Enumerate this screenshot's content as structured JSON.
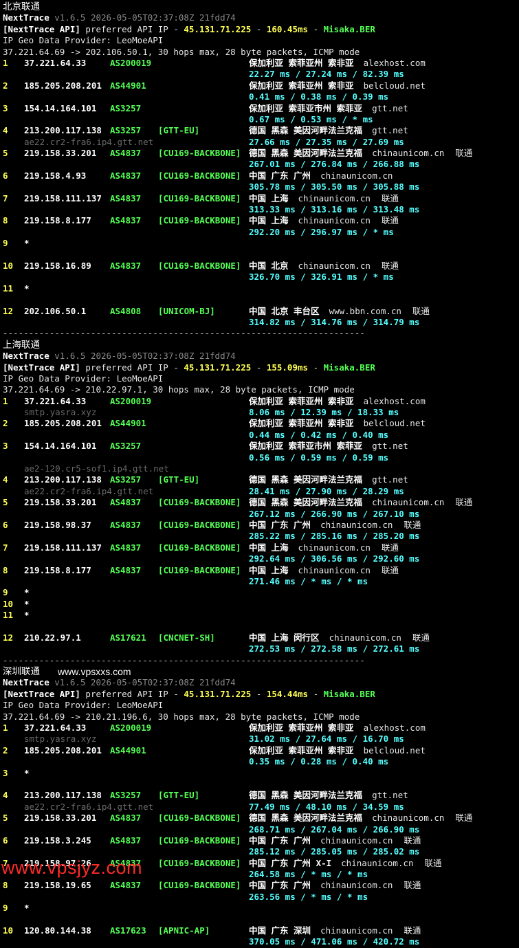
{
  "watermark_top": "www.vpsxxs.com",
  "watermark_bottom": "www.vpsjyz.com",
  "sections": [
    {
      "label": "北京联通",
      "app": "NextTrace",
      "version": "v1.6.5 2026-05-05T02:37:08Z 21fdd74",
      "api_prefix": "[NextTrace API]",
      "api_text": " preferred API IP - ",
      "api_ip": "45.131.71.225",
      "api_dash1": " - ",
      "api_ms": "160.45ms",
      "api_dash2": " - ",
      "api_host": "Misaka.BER",
      "geo_provider": "IP Geo Data Provider: LeoMoeAPI",
      "route": "37.221.64.69 -> 202.106.50.1, 30 hops max, 28 byte packets, ICMP mode",
      "hops": [
        {
          "n": "1",
          "ip": "37.221.64.33",
          "asn": "AS200019",
          "tag": "",
          "geo": "保加利亚 索菲亚州 索非亚",
          "dom": "alexhost.com",
          "isp": "",
          "rtt": "22.27 ms / 27.24 ms / 82.39 ms",
          "rdns": ""
        },
        {
          "n": "2",
          "ip": "185.205.208.201",
          "asn": "AS44901",
          "tag": "",
          "geo": "保加利亚 索菲亚州 索非亚",
          "dom": "belcloud.net",
          "isp": "",
          "rtt": "0.41 ms / 0.38 ms / 0.39 ms",
          "rdns": ""
        },
        {
          "n": "3",
          "ip": "154.14.164.101",
          "asn": "AS3257",
          "tag": "",
          "geo": "保加利亚 索菲亚市州 索菲亚",
          "dom": "gtt.net",
          "isp": "",
          "rtt": "0.67 ms / 0.53 ms / * ms",
          "rdns": ""
        },
        {
          "n": "4",
          "ip": "213.200.117.138",
          "asn": "AS3257",
          "tag": "[GTT-EU]",
          "geo": "德国 黑森 美因河畔法兰克福",
          "dom": "gtt.net",
          "isp": "",
          "rtt": "27.66 ms / 27.35 ms / 27.69 ms",
          "rdns": "ae22.cr2-fra6.ip4.gtt.net"
        },
        {
          "n": "5",
          "ip": "219.158.33.201",
          "asn": "AS4837",
          "tag": "[CU169-BACKBONE]",
          "geo": "德国 黑森 美因河畔法兰克福",
          "dom": "chinaunicom.cn",
          "isp": "联通",
          "rtt": "267.01 ms / 276.84 ms / 266.88 ms",
          "rdns": ""
        },
        {
          "n": "6",
          "ip": "219.158.4.93",
          "asn": "AS4837",
          "tag": "[CU169-BACKBONE]",
          "geo": "中国 广东 广州",
          "dom": "chinaunicom.cn",
          "isp": "",
          "rtt": "305.78 ms / 305.50 ms / 305.88 ms",
          "rdns": ""
        },
        {
          "n": "7",
          "ip": "219.158.111.137",
          "asn": "AS4837",
          "tag": "[CU169-BACKBONE]",
          "geo": "中国 上海",
          "dom": "chinaunicom.cn",
          "isp": "联通",
          "rtt": "313.33 ms / 313.16 ms / 313.48 ms",
          "rdns": ""
        },
        {
          "n": "8",
          "ip": "219.158.8.177",
          "asn": "AS4837",
          "tag": "[CU169-BACKBONE]",
          "geo": "中国 上海",
          "dom": "chinaunicom.cn",
          "isp": "联通",
          "rtt": "292.20 ms / 296.97 ms / * ms",
          "rdns": ""
        },
        {
          "n": "9",
          "ip": "*",
          "asn": "",
          "tag": "",
          "geo": "",
          "dom": "",
          "isp": "",
          "rtt": "",
          "rdns": ""
        },
        {
          "n": "10",
          "ip": "219.158.16.89",
          "asn": "AS4837",
          "tag": "[CU169-BACKBONE]",
          "geo": "中国 北京",
          "dom": "chinaunicom.cn",
          "isp": "联通",
          "rtt": "326.70 ms / 326.91 ms / * ms",
          "rdns": ""
        },
        {
          "n": "11",
          "ip": "*",
          "asn": "",
          "tag": "",
          "geo": "",
          "dom": "",
          "isp": "",
          "rtt": "",
          "rdns": ""
        },
        {
          "n": "12",
          "ip": "202.106.50.1",
          "asn": "AS4808",
          "tag": "[UNICOM-BJ]",
          "geo": "中国 北京 丰台区",
          "dom": "www.bbn.com.cn",
          "isp": "联通",
          "rtt": "314.82 ms / 314.76 ms / 314.79 ms",
          "rdns": ""
        }
      ]
    },
    {
      "label": "上海联通",
      "app": "NextTrace",
      "version": "v1.6.5 2026-05-05T02:37:08Z 21fdd74",
      "api_prefix": "[NextTrace API]",
      "api_text": " preferred API IP - ",
      "api_ip": "45.131.71.225",
      "api_dash1": " - ",
      "api_ms": "155.09ms",
      "api_dash2": " - ",
      "api_host": "Misaka.BER",
      "geo_provider": "IP Geo Data Provider: LeoMoeAPI",
      "route": "37.221.64.69 -> 210.22.97.1, 30 hops max, 28 byte packets, ICMP mode",
      "hops": [
        {
          "n": "1",
          "ip": "37.221.64.33",
          "asn": "AS200019",
          "tag": "",
          "geo": "保加利亚 索菲亚州 索非亚",
          "dom": "alexhost.com",
          "isp": "",
          "rtt": "8.06 ms / 12.39 ms / 18.33 ms",
          "rdns": "smtp.yasra.xyz",
          "rdns_first": true
        },
        {
          "n": "2",
          "ip": "185.205.208.201",
          "asn": "AS44901",
          "tag": "",
          "geo": "保加利亚 索菲亚州 索非亚",
          "dom": "belcloud.net",
          "isp": "",
          "rtt": "0.44 ms / 0.42 ms / 0.40 ms",
          "rdns": ""
        },
        {
          "n": "3",
          "ip": "154.14.164.101",
          "asn": "AS3257",
          "tag": "",
          "geo": "保加利亚 索菲亚市州 索菲亚",
          "dom": "gtt.net",
          "isp": "",
          "rtt": "0.56 ms / 0.59 ms / 0.59 ms",
          "rdns": "ae2-120.cr5-sof1.ip4.gtt.net",
          "rdns_after_rtt": true
        },
        {
          "n": "4",
          "ip": "213.200.117.138",
          "asn": "AS3257",
          "tag": "[GTT-EU]",
          "geo": "德国 黑森 美因河畔法兰克福",
          "dom": "gtt.net",
          "isp": "",
          "rtt": "28.41 ms / 27.90 ms / 28.29 ms",
          "rdns": "ae22.cr2-fra6.ip4.gtt.net"
        },
        {
          "n": "5",
          "ip": "219.158.33.201",
          "asn": "AS4837",
          "tag": "[CU169-BACKBONE]",
          "geo": "德国 黑森 美因河畔法兰克福",
          "dom": "chinaunicom.cn",
          "isp": "联通",
          "rtt": "267.12 ms / 266.90 ms / 267.10 ms",
          "rdns": ""
        },
        {
          "n": "6",
          "ip": "219.158.98.37",
          "asn": "AS4837",
          "tag": "[CU169-BACKBONE]",
          "geo": "中国 广东 广州",
          "dom": "chinaunicom.cn",
          "isp": "联通",
          "rtt": "285.22 ms / 285.16 ms / 285.20 ms",
          "rdns": ""
        },
        {
          "n": "7",
          "ip": "219.158.111.137",
          "asn": "AS4837",
          "tag": "[CU169-BACKBONE]",
          "geo": "中国 上海",
          "dom": "chinaunicom.cn",
          "isp": "联通",
          "rtt": "292.64 ms / 306.56 ms / 292.60 ms",
          "rdns": ""
        },
        {
          "n": "8",
          "ip": "219.158.8.177",
          "asn": "AS4837",
          "tag": "[CU169-BACKBONE]",
          "geo": "中国 上海",
          "dom": "chinaunicom.cn",
          "isp": "联通",
          "rtt": "271.46 ms / * ms / * ms",
          "rdns": ""
        },
        {
          "n": "9",
          "ip": "*",
          "asn": "",
          "tag": "",
          "geo": "",
          "dom": "",
          "isp": "",
          "rtt": "",
          "rdns": "",
          "compact": true
        },
        {
          "n": "10",
          "ip": "*",
          "asn": "",
          "tag": "",
          "geo": "",
          "dom": "",
          "isp": "",
          "rtt": "",
          "rdns": "",
          "compact": true
        },
        {
          "n": "11",
          "ip": "*",
          "asn": "",
          "tag": "",
          "geo": "",
          "dom": "",
          "isp": "",
          "rtt": "",
          "rdns": ""
        },
        {
          "n": "12",
          "ip": "210.22.97.1",
          "asn": "AS17621",
          "tag": "[CNCNET-SH]",
          "geo": "中国 上海 闵行区",
          "dom": "chinaunicom.cn",
          "isp": "联通",
          "rtt": "272.53 ms / 272.58 ms / 272.61 ms",
          "rdns": ""
        }
      ]
    },
    {
      "label": "深圳联通",
      "app": "NextTrace",
      "version": "v1.6.5 2026-05-05T02:37:08Z 21fdd74",
      "api_prefix": "[NextTrace API]",
      "api_text": " preferred API IP - ",
      "api_ip": "45.131.71.225",
      "api_dash1": " - ",
      "api_ms": "154.44ms",
      "api_dash2": " - ",
      "api_host": "Misaka.BER",
      "geo_provider": "IP Geo Data Provider: LeoMoeAPI",
      "route": "37.221.64.69 -> 210.21.196.6, 30 hops max, 28 byte packets, ICMP mode",
      "hops": [
        {
          "n": "1",
          "ip": "37.221.64.33",
          "asn": "AS200019",
          "tag": "",
          "geo": "保加利亚 索菲亚州 索非亚",
          "dom": "alexhost.com",
          "isp": "",
          "rtt": "31.02 ms / 27.64 ms / 16.70 ms",
          "rdns": "smtp.yasra.xyz",
          "rdns_first": true
        },
        {
          "n": "2",
          "ip": "185.205.208.201",
          "asn": "AS44901",
          "tag": "",
          "geo": "保加利亚 索菲亚州 索非亚",
          "dom": "belcloud.net",
          "isp": "",
          "rtt": "0.35 ms / 0.28 ms / 0.40 ms",
          "rdns": ""
        },
        {
          "n": "3",
          "ip": "*",
          "asn": "",
          "tag": "",
          "geo": "",
          "dom": "",
          "isp": "",
          "rtt": "",
          "rdns": ""
        },
        {
          "n": "4",
          "ip": "213.200.117.138",
          "asn": "AS3257",
          "tag": "[GTT-EU]",
          "geo": "德国 黑森 美因河畔法兰克福",
          "dom": "gtt.net",
          "isp": "",
          "rtt": "77.49 ms / 48.10 ms / 34.59 ms",
          "rdns": "ae22.cr2-fra6.ip4.gtt.net"
        },
        {
          "n": "5",
          "ip": "219.158.33.201",
          "asn": "AS4837",
          "tag": "[CU169-BACKBONE]",
          "geo": "德国 黑森 美因河畔法兰克福",
          "dom": "chinaunicom.cn",
          "isp": "联通",
          "rtt": "268.71 ms / 267.04 ms / 266.90 ms",
          "rdns": ""
        },
        {
          "n": "6",
          "ip": "219.158.3.245",
          "asn": "AS4837",
          "tag": "[CU169-BACKBONE]",
          "geo": "中国 广东 广州",
          "dom": "chinaunicom.cn",
          "isp": "联通",
          "rtt": "285.12 ms / 285.05 ms / 285.02 ms",
          "rdns": ""
        },
        {
          "n": "7",
          "ip": "219.158.97.26",
          "asn": "AS4837",
          "tag": "[CU169-BACKBONE]",
          "geo": "中国 广东 广州 X-I",
          "dom": "chinaunicom.cn",
          "isp": "联通",
          "rtt": "264.58 ms / * ms / * ms",
          "rdns": ""
        },
        {
          "n": "8",
          "ip": "219.158.19.65",
          "asn": "AS4837",
          "tag": "[CU169-BACKBONE]",
          "geo": "中国 广东 广州",
          "dom": "chinaunicom.cn",
          "isp": "联通",
          "rtt": "263.56 ms / * ms / * ms",
          "rdns": ""
        },
        {
          "n": "9",
          "ip": "*",
          "asn": "",
          "tag": "",
          "geo": "",
          "dom": "",
          "isp": "",
          "rtt": "",
          "rdns": ""
        },
        {
          "n": "10",
          "ip": "120.80.144.38",
          "asn": "AS17623",
          "tag": "[APNIC-AP]",
          "geo": "中国 广东 深圳",
          "dom": "chinaunicom.cn",
          "isp": "联通",
          "rtt": "370.05 ms / 471.06 ms / 420.72 ms",
          "rdns": ""
        }
      ]
    }
  ],
  "separator": "----------------------------------------------------------------------"
}
